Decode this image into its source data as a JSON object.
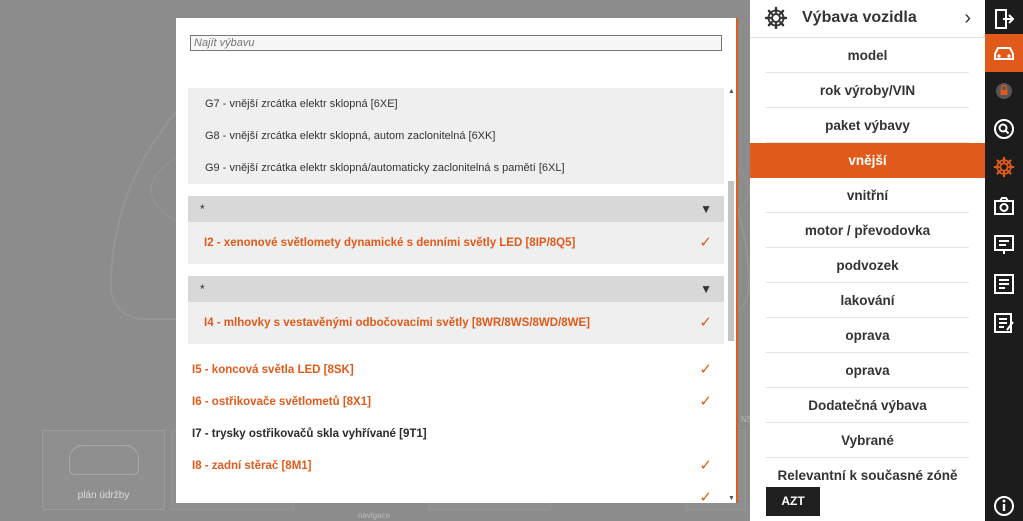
{
  "background": {
    "tiles": [
      {
        "label": "plán údržby"
      }
    ],
    "fragments": {
      "navigation": "navigace",
      "ns": "NS"
    }
  },
  "dialog": {
    "search": {
      "placeholder": "Najít výbavu",
      "value": ""
    },
    "scroll": {
      "up": "▲",
      "down": "▼"
    },
    "top_options": [
      {
        "label": "G7 - vnější zrcátka elektr sklopná [6XE]"
      },
      {
        "label": "G8 - vnější zrcátka elektr sklopná, autom zaclonitelná [6XK]"
      },
      {
        "label": "G9 - vnější zrcátka elektr sklopná/automaticky zaclonitelná s pamětí [6XL]"
      }
    ],
    "groups": [
      {
        "marker": "*",
        "toggle": "▼",
        "selected": {
          "label": "I2 - xenonové světlomety dynamické s denními světly LED [8IP/8Q5]",
          "check": "✓"
        }
      },
      {
        "marker": "*",
        "toggle": "▼",
        "selected": {
          "label": "I4 - mlhovky s vestavěnými odbočovacími světly [8WR/8WS/8WD/8WE]",
          "check": "✓"
        }
      }
    ],
    "items": [
      {
        "label": "I5 - koncová světla LED [8SK]",
        "selected": true,
        "check": "✓"
      },
      {
        "label": "I6 - ostřikovače světlometů [8X1]",
        "selected": true,
        "check": "✓"
      },
      {
        "label": "I7 - trysky ostřikovačů skla vyhřívané [9T1]",
        "selected": false,
        "check": ""
      },
      {
        "label": "I8 - zadní stěrač [8M1]",
        "selected": true,
        "check": "✓"
      },
      {
        "label": "",
        "selected": true,
        "check": "✓"
      }
    ]
  },
  "panel": {
    "title": "Výbava vozidla",
    "chevron": "›",
    "menu": [
      {
        "label": "model",
        "active": false
      },
      {
        "label": "rok výroby/VIN",
        "active": false
      },
      {
        "label": "paket výbavy",
        "active": false
      },
      {
        "label": "vnější",
        "active": true
      },
      {
        "label": "vnitřní",
        "active": false
      },
      {
        "label": "motor / převodovka",
        "active": false
      },
      {
        "label": "podvozek",
        "active": false
      },
      {
        "label": "lakování",
        "active": false
      },
      {
        "label": "oprava",
        "active": false
      },
      {
        "label": "oprava",
        "active": false
      },
      {
        "label": "Dodatečná výbava",
        "active": false
      },
      {
        "label": "Vybrané",
        "active": false
      },
      {
        "label": "Relevantní k současné zóně",
        "active": false
      }
    ],
    "footer_button": "AZT"
  },
  "rail": {
    "icons": [
      "exit-icon",
      "car-icon",
      "lock-icon",
      "search-icon",
      "gear-icon",
      "camera-icon",
      "presentation-icon",
      "checklist-icon",
      "notes-icon",
      "info-icon"
    ],
    "active": "car-icon",
    "accent": "#e05a1b"
  },
  "colors": {
    "accent": "#e05a1b",
    "rail": "#1c1c1c",
    "overlay": "#8c8c8c"
  }
}
